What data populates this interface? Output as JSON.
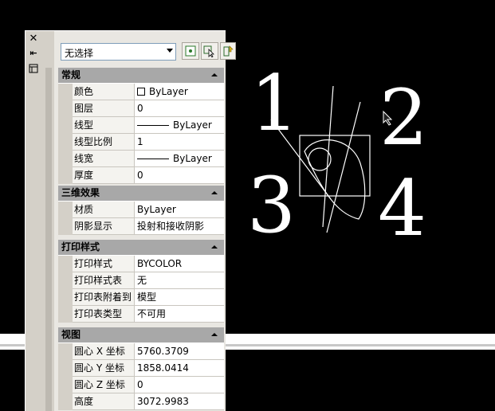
{
  "toolbar": {
    "selection_value": "无选择",
    "buttons": [
      "toggle-pickadd-icon",
      "select-objects-icon",
      "quick-select-icon"
    ]
  },
  "titlebar_icons": [
    "close-icon",
    "autohide-icon",
    "properties-icon"
  ],
  "sections": [
    {
      "title": "常规",
      "rows": [
        {
          "key": "颜色",
          "value": "ByLayer",
          "marker": "swatch"
        },
        {
          "key": "图层",
          "value": "0"
        },
        {
          "key": "线型",
          "value": "ByLayer",
          "marker": "line"
        },
        {
          "key": "线型比例",
          "value": "1"
        },
        {
          "key": "线宽",
          "value": "ByLayer",
          "marker": "line"
        },
        {
          "key": "厚度",
          "value": "0"
        }
      ]
    },
    {
      "title": "三维效果",
      "rows": [
        {
          "key": "材质",
          "value": "ByLayer"
        },
        {
          "key": "阴影显示",
          "value": "投射和接收阴影"
        }
      ]
    },
    {
      "title": "打印样式",
      "rows": [
        {
          "key": "打印样式",
          "value": "BYCOLOR"
        },
        {
          "key": "打印样式表",
          "value": "无"
        },
        {
          "key": "打印表附着到",
          "value": "模型"
        },
        {
          "key": "打印表类型",
          "value": "不可用"
        }
      ]
    },
    {
      "title": "视图",
      "rows": [
        {
          "key": "圆心 X 坐标",
          "value": "5760.3709"
        },
        {
          "key": "圆心 Y 坐标",
          "value": "1858.0414"
        },
        {
          "key": "圆心 Z 坐标",
          "value": "0"
        },
        {
          "key": "高度",
          "value": "3072.9983"
        }
      ]
    }
  ],
  "canvas": {
    "labels": [
      "1",
      "2",
      "3",
      "4"
    ]
  }
}
